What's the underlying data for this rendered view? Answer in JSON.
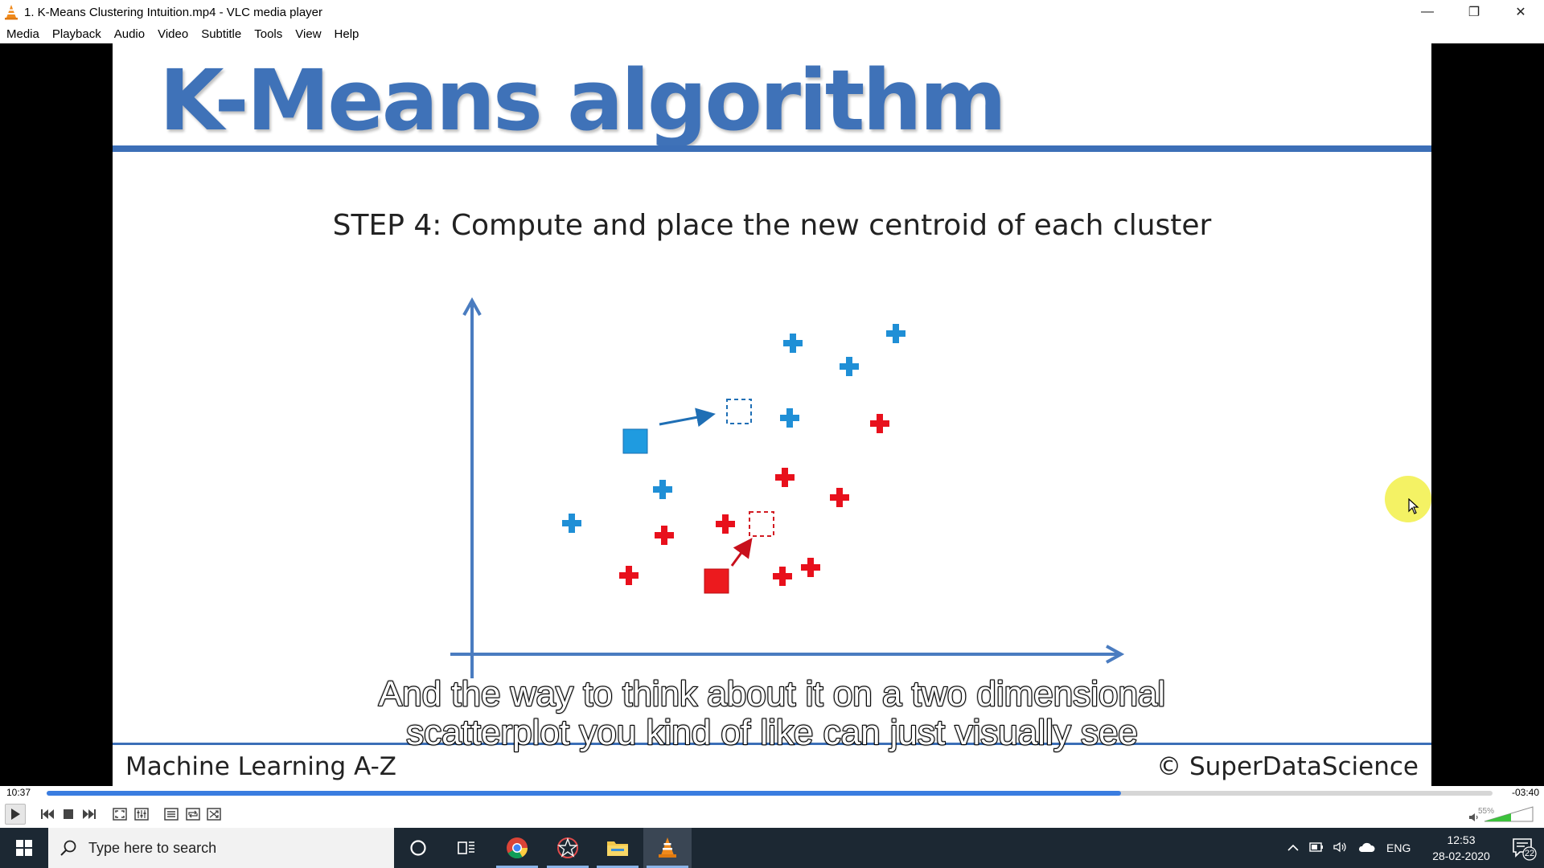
{
  "window": {
    "title": "1. K-Means Clustering Intuition.mp4 - VLC media player"
  },
  "menu": [
    "Media",
    "Playback",
    "Audio",
    "Video",
    "Subtitle",
    "Tools",
    "View",
    "Help"
  ],
  "slide": {
    "title": "K-Means algorithm",
    "step_label": "STEP 4: Compute and place the new centroid of each cluster",
    "footer_left": "Machine Learning A-Z",
    "footer_right": "© SuperDataScience"
  },
  "subtitle": {
    "line1": "And the way to think about it on a two dimensional",
    "line2": "scatterplot you kind of like can just visually see"
  },
  "colors": {
    "blue_cluster": "#1f8fd6",
    "red_cluster": "#e8101c",
    "axis": "#4a7cc0",
    "slide_accent": "#3c6fb7",
    "seek_fill": "#3a7de0"
  },
  "playback": {
    "elapsed": "10:37",
    "remaining": "-03:40",
    "progress": 0.743,
    "volume_label": "55%",
    "volume": 0.55
  },
  "taskbar": {
    "search_placeholder": "Type here to search",
    "language": "ENG",
    "time": "12:53",
    "date": "28-02-2020",
    "notification_count": "22"
  }
}
